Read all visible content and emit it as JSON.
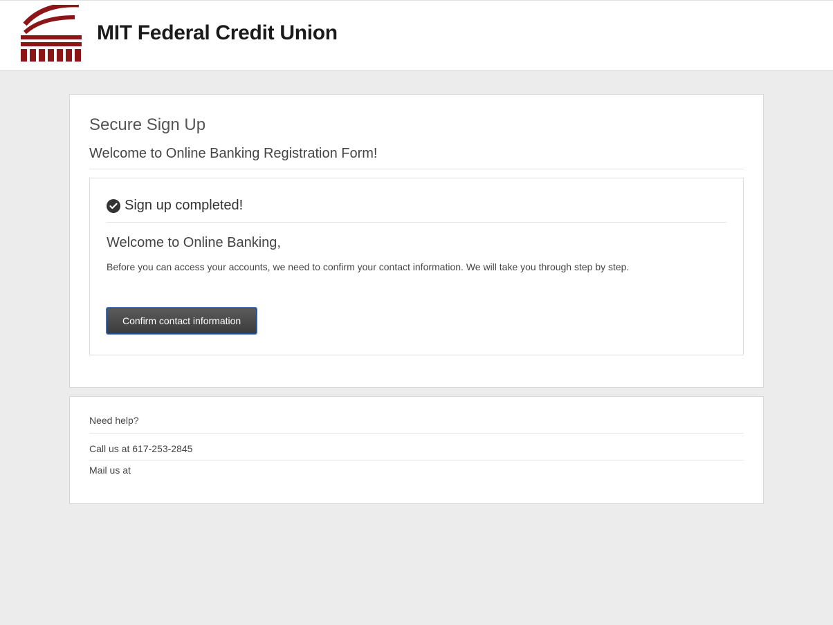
{
  "header": {
    "brand": "MIT Federal Credit Union"
  },
  "main": {
    "title": "Secure Sign Up",
    "subtitle": "Welcome to Online Banking Registration Form!",
    "panel": {
      "status": "Sign up completed!",
      "welcome": "Welcome to Online Banking,",
      "body": "Before you can access your accounts, we need to confirm your contact information. We will take you through step by step.",
      "confirm_label": "Confirm contact information"
    }
  },
  "help": {
    "title": "Need help?",
    "call": "Call us at 617-253-2845",
    "mail": "Mail us at"
  }
}
